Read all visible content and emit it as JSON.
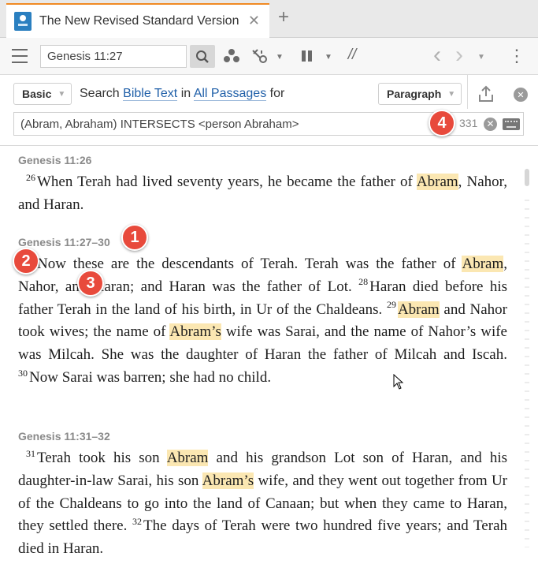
{
  "tab": {
    "title": "The New Revised Standard Version",
    "close_glyph": "✕",
    "add_glyph": "+",
    "icon_text": "NRSV"
  },
  "toolbar": {
    "reference": "Genesis 11:27",
    "parallel_glyph": "//",
    "back_glyph": "‹",
    "forward_glyph": "›",
    "more_glyph": "⋮"
  },
  "search": {
    "mode": "Basic",
    "prefix": "Search",
    "target": "Bible Text",
    "in_word": "in",
    "scope": "All Passages",
    "for_word": "for",
    "display": "Paragraph",
    "query": "(Abram, Abraham) INTERSECTS <person Abraham>",
    "count": "331"
  },
  "passages": [
    {
      "ref": "Genesis 11:26",
      "text_html": "<span class=\"vn\">26</span>When Terah had lived seventy years, he became the father of <span class=\"hl\">Abram</span>, Nahor, and Haran."
    },
    {
      "ref": "Genesis 11:27–30",
      "text_html": "<span class=\"vn\">27</span>Now these are the descendants of Terah. Terah was the father of <span class=\"hl\">Abram</span>, Nahor, and Haran; and Haran was the father of Lot. <span class=\"vn\">28</span>Haran died before his father Terah in the land of his birth, in Ur of the Chaldeans. <span class=\"vn\">29</span><span class=\"hl\">Abram</span> and Nahor took wives; the name of <span class=\"hl\">Abram’s</span> wife was Sarai, and the name of Nahor’s wife was Milcah. She was the daughter of Haran the father of Milcah and Iscah. <span class=\"vn\">30</span>Now Sarai was barren; she had no child."
    },
    {
      "ref": "Genesis 11:31–32",
      "text_html": "<span class=\"vn\">31</span>Terah took his son <span class=\"hl\">Abram</span> and his grandson Lot son of Haran, and his daughter-in-law Sarai, his son <span class=\"hl\">Abram’s</span> wife, and they went out together from Ur of the Chaldeans to go into the land of Canaan; but when they came to Haran, they settled there. <span class=\"vn\">32</span>The days of Terah were two hundred five years; and Terah died in Haran."
    }
  ],
  "callouts": [
    "1",
    "2",
    "3",
    "4"
  ],
  "colors": {
    "accent_tab": "#f08a24",
    "highlight": "#fbe7b2",
    "callout": "#e84a3c",
    "link": "#1f5fa8"
  }
}
